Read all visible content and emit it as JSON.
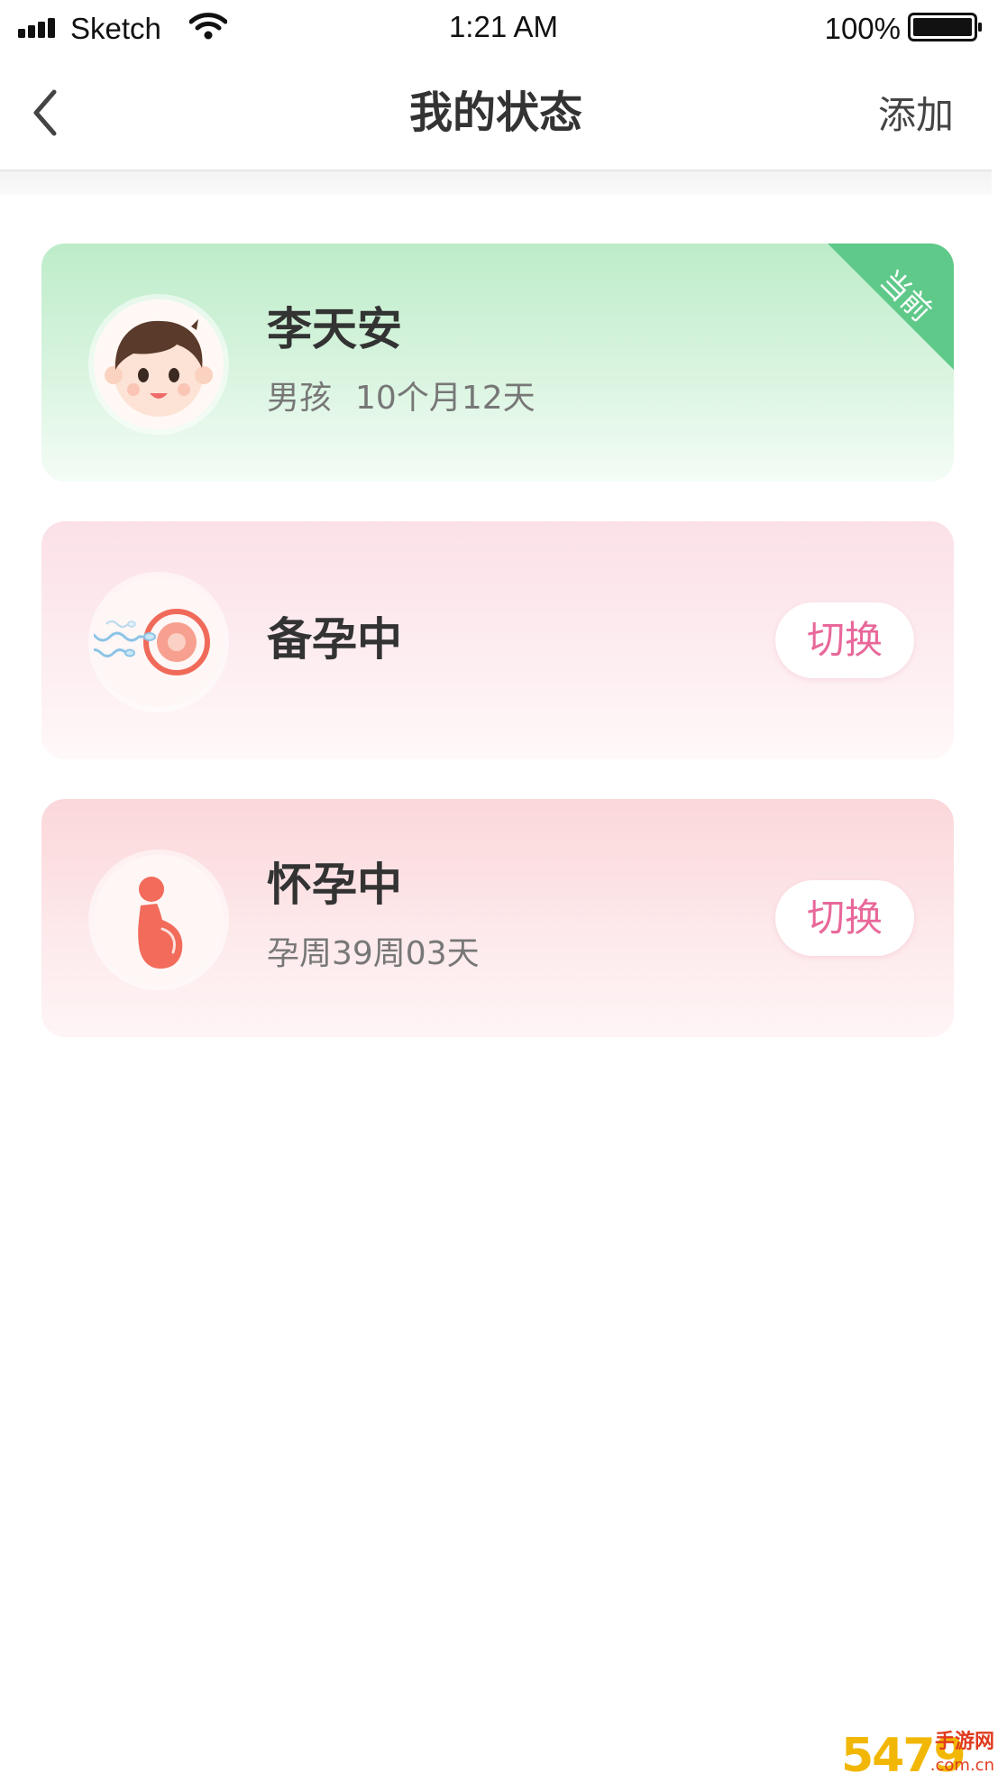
{
  "status_bar": {
    "carrier": "Sketch",
    "time": "1:21 AM",
    "battery_percent": "100%"
  },
  "nav": {
    "title": "我的状态",
    "add_label": "添加",
    "back_icon": "chevron-left-icon"
  },
  "cards": [
    {
      "name": "李天安",
      "gender": "男孩",
      "age": "10个月12天",
      "badge": "当前",
      "icon": "boy-face-icon",
      "accent": "#5fc98a"
    },
    {
      "name": "备孕中",
      "switch_label": "切换",
      "icon": "sperm-egg-icon",
      "accent": "#f06a5a"
    },
    {
      "name": "怀孕中",
      "detail": "孕周39周03天",
      "switch_label": "切换",
      "icon": "pregnant-woman-icon",
      "accent": "#f06a5a"
    }
  ],
  "watermark": {
    "digits": "5479",
    "site": "手游网",
    "domain": ".com.cn"
  },
  "colors": {
    "switch_text": "#e8689a",
    "badge_green": "#5fc98a"
  }
}
